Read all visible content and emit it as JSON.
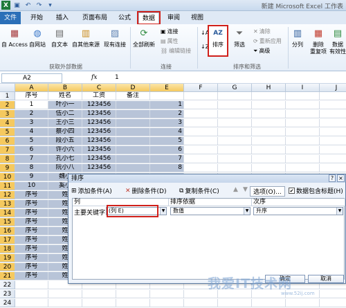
{
  "window": {
    "title": "新建 Microsoft Excel 工作表"
  },
  "tabs": [
    "文件",
    "开始",
    "插入",
    "页面布局",
    "公式",
    "数据",
    "审阅",
    "视图"
  ],
  "ribbon": {
    "get_external": {
      "access": "自 Access",
      "web": "自网站",
      "text": "自文本",
      "other": "自其他来源",
      "existing": "现有连接",
      "group": "获取外部数据"
    },
    "connections": {
      "refresh_all": "全部刷新",
      "connections": "连接",
      "properties": "属性",
      "edit_links": "编辑链接",
      "group": "连接"
    },
    "sort_filter": {
      "sort": "排序",
      "filter": "筛选",
      "clear": "清除",
      "reapply": "重新应用",
      "advanced": "高级",
      "group": "排序和筛选"
    },
    "tools": {
      "split": "分列",
      "remove_dup": "删除",
      "remove_dup2": "重复项",
      "validation": "数据",
      "validation2": "有效性"
    }
  },
  "formula_bar": {
    "name_box": "A2",
    "fx": "fx",
    "value": "1"
  },
  "columns": [
    "A",
    "B",
    "C",
    "D",
    "E",
    "F",
    "G",
    "H",
    "I",
    "J"
  ],
  "rows": [
    "1",
    "2",
    "3",
    "4",
    "5",
    "6",
    "7",
    "8",
    "9",
    "10",
    "11",
    "12",
    "13",
    "14",
    "15",
    "16",
    "17",
    "18",
    "19",
    "20",
    "21",
    "22",
    "23",
    "24"
  ],
  "cells": {
    "header": [
      "序号",
      "姓名",
      "工资",
      "备注"
    ],
    "data": [
      [
        "1",
        "叶小一",
        "123456",
        ""
      ],
      [
        "2",
        "伍小二",
        "123456",
        ""
      ],
      [
        "3",
        "王小三",
        "123456",
        ""
      ],
      [
        "4",
        "蔡小四",
        "123456",
        ""
      ],
      [
        "5",
        "段小五",
        "123456",
        ""
      ],
      [
        "6",
        "许小六",
        "123456",
        ""
      ],
      [
        "7",
        "孔小七",
        "123456",
        ""
      ],
      [
        "8",
        "阮小八",
        "123456",
        ""
      ],
      [
        "9",
        "魏小",
        "",
        ""
      ],
      [
        "10",
        "奚小",
        "",
        ""
      ],
      [
        "序号",
        "姓",
        "",
        ""
      ],
      [
        "序号",
        "姓",
        "",
        ""
      ],
      [
        "序号",
        "姓",
        "",
        ""
      ],
      [
        "序号",
        "姓",
        "",
        ""
      ],
      [
        "序号",
        "姓",
        "",
        ""
      ],
      [
        "序号",
        "姓",
        "",
        ""
      ],
      [
        "序号",
        "姓",
        "",
        ""
      ],
      [
        "序号",
        "姓",
        "",
        ""
      ],
      [
        "序号",
        "姓",
        "",
        ""
      ],
      [
        "序号",
        "姓",
        "",
        ""
      ]
    ],
    "col_e": [
      "1",
      "2",
      "3",
      "4",
      "5",
      "6",
      "7",
      "8"
    ]
  },
  "dialog": {
    "title": "排序",
    "help": "?",
    "close": "×",
    "add_level": "添加条件(A)",
    "delete_level": "删除条件(D)",
    "copy_level": "复制条件(C)",
    "options": "选项(O)...",
    "has_headers": "数据包含标题(H)",
    "col_header_column": "列",
    "col_header_sort_on": "排序依据",
    "col_header_order": "次序",
    "primary_key_label": "主要关键字",
    "primary_key_value": "(列 E)",
    "sort_on_value": "数值",
    "order_value": "升序",
    "ok": "确定",
    "cancel": "取消"
  },
  "watermark": {
    "text": "我爱IT技术网",
    "url": "www.52ij.com"
  }
}
